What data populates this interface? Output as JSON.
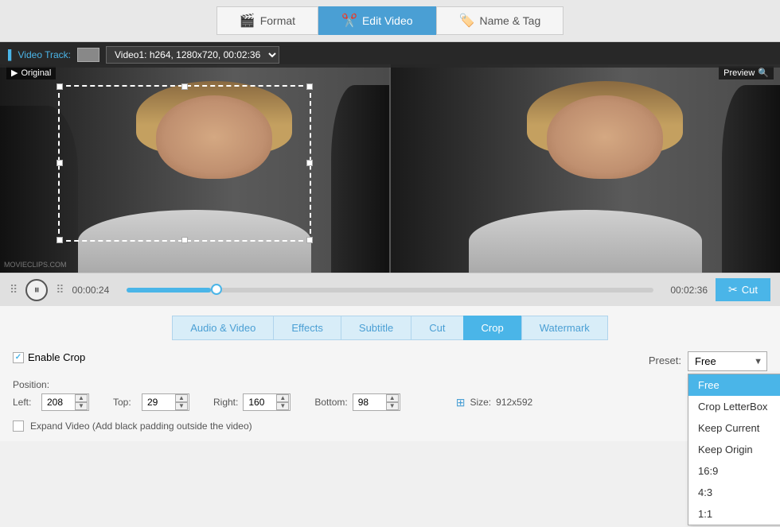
{
  "nav": {
    "tabs": [
      {
        "id": "format",
        "label": "Format",
        "icon": "🎬",
        "active": false
      },
      {
        "id": "edit-video",
        "label": "Edit Video",
        "icon": "✂️",
        "active": true
      },
      {
        "id": "name-tag",
        "label": "Name & Tag",
        "icon": "🏷️",
        "active": false
      }
    ]
  },
  "video_track": {
    "label": "Video Track:",
    "info": "Video1: h264, 1280x720, 00:02:36"
  },
  "labels": {
    "original": "Original",
    "preview": "Preview",
    "play_icon": "▶",
    "pause_icon": "⏸",
    "time_current": "00:00:24",
    "time_total": "00:02:36",
    "cut": "Cut",
    "watermark": "MOVIECLIPS.COM"
  },
  "tabs": [
    {
      "id": "audio-video",
      "label": "Audio & Video",
      "active": false
    },
    {
      "id": "effects",
      "label": "Effects",
      "active": false
    },
    {
      "id": "subtitle",
      "label": "Subtitle",
      "active": false
    },
    {
      "id": "cut",
      "label": "Cut",
      "active": false
    },
    {
      "id": "crop",
      "label": "Crop",
      "active": true
    },
    {
      "id": "watermark",
      "label": "Watermark",
      "active": false
    }
  ],
  "crop": {
    "enable_label": "Enable Crop",
    "enable_checked": true,
    "preset_label": "Preset:",
    "preset_value": "Free",
    "preset_options": [
      "Free",
      "Crop LetterBox",
      "Keep Current",
      "Keep Origin",
      "16:9",
      "4:3",
      "1:1"
    ],
    "position_label": "Position:",
    "left_label": "Left:",
    "left_value": "208",
    "top_label": "Top:",
    "top_value": "29",
    "right_label": "Right:",
    "right_value": "160",
    "bottom_label": "Bottom:",
    "bottom_value": "98",
    "size_label": "Size:",
    "size_value": "912x592",
    "expand_label": "Expand Video (Add black padding outside the video)"
  }
}
